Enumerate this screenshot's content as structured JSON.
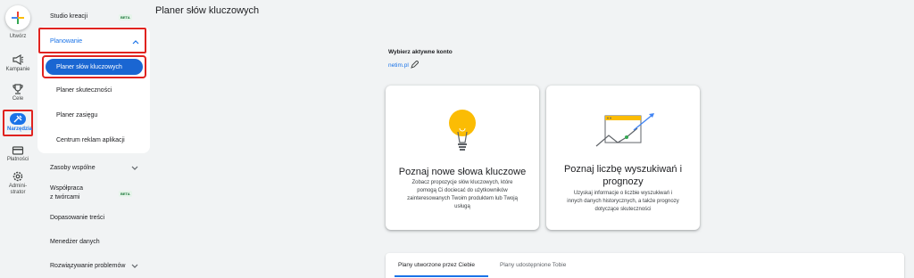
{
  "rail": {
    "create_label": "Utwórz",
    "items": [
      {
        "label": "Kampanie",
        "icon": "megaphone-icon"
      },
      {
        "label": "Cele",
        "icon": "trophy-icon"
      },
      {
        "label": "Narzędzia",
        "icon": "tools-icon",
        "active": true
      },
      {
        "label": "Płatności",
        "icon": "card-icon"
      },
      {
        "label": "Admini-",
        "label2": "strator",
        "icon": "gear-icon"
      }
    ]
  },
  "sidenav": {
    "studio": {
      "label": "Studio kreacji",
      "badge": "BETA"
    },
    "planning": {
      "label": "Planowanie",
      "items": [
        "Planer słów kluczowych",
        "Planer skuteczności",
        "Planer zasięgu",
        "Centrum reklam aplikacji"
      ]
    },
    "shared": "Zasoby wspólne",
    "creators": {
      "line1": "Współpraca",
      "line2": "z twórcami",
      "badge": "BETA"
    },
    "content_match": "Dopasowanie treści",
    "data_manager": "Menedżer danych",
    "troubleshooting": "Rozwiązywanie problemów"
  },
  "main": {
    "title": "Planer słów kluczowych",
    "account": {
      "label": "Wybierz aktywne konto",
      "value": "netim.pl"
    },
    "cards": [
      {
        "title": "Poznaj nowe słowa kluczowe",
        "desc": [
          "Zobacz propozycje słów kluczowych, które",
          "pomogą Ci dociecać do użytkowników",
          "zainteresowanych Twoim produktem lub Twoją",
          "usługą"
        ]
      },
      {
        "title1": "Poznaj liczbę wyszukiwań i",
        "title2": "prognozy",
        "desc": [
          "Uzyskaj informacje o liczbie wyszukiwań i",
          "innych danych historycznych, a także prognozy",
          "dotyczące skuteczności"
        ]
      }
    ],
    "tabs": [
      "Plany utworzone przez Ciebie",
      "Plany udostępnione Tobie"
    ]
  },
  "colors": {
    "accent": "#1a73e8",
    "highlight": "#e0231f",
    "selected": "#1a66d2"
  }
}
